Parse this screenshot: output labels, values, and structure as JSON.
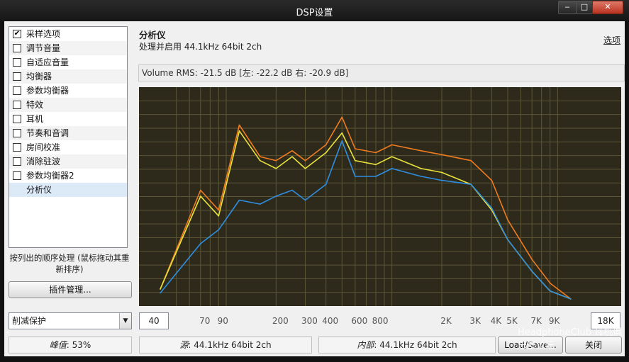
{
  "window": {
    "title": "DSP设置"
  },
  "sidebar": {
    "items": [
      {
        "label": "采样选项",
        "checked": true
      },
      {
        "label": "调节音量",
        "checked": false
      },
      {
        "label": "自适应音量",
        "checked": false
      },
      {
        "label": "均衡器",
        "checked": false
      },
      {
        "label": "参数均衡器",
        "checked": false
      },
      {
        "label": "特效",
        "checked": false
      },
      {
        "label": "耳机",
        "checked": false
      },
      {
        "label": "节奏和音调",
        "checked": false
      },
      {
        "label": "房间校准",
        "checked": false
      },
      {
        "label": "消除驻波",
        "checked": false
      },
      {
        "label": "参数均衡器2",
        "checked": false
      },
      {
        "label": "分析仪",
        "selected": true
      }
    ],
    "order_note": "按列出的顺序处理 (鼠标拖动其重新排序)",
    "plugin_button": "插件管理...",
    "clip_mode": "削减保护"
  },
  "panel": {
    "title": "分析仪",
    "subtitle": "处理并启用 44.1kHz 64bit 2ch",
    "options_link": "选项",
    "rms_text": "Volume RMS: -21.5 dB   [左: -22.2 dB   右: -20.9 dB]"
  },
  "freq": {
    "min": "40",
    "max": "18K",
    "ticks": [
      "70",
      "90",
      "200",
      "300",
      "400",
      "600",
      "800",
      "2K",
      "3K",
      "4K",
      "5K",
      "7K",
      "9K"
    ]
  },
  "statusbar": {
    "peak_label": "峰值",
    "peak_value": ": 53%",
    "source_label": "源",
    "source_value": ": 44.1kHz 64bit 2ch",
    "internal_label": "内部",
    "internal_value": ": 44.1kHz 64bit 2ch",
    "load_save": "Load/Save...",
    "close": "关闭"
  },
  "watermark": "HeadphoneClub 耳机俱乐部论坛",
  "chart_data": {
    "type": "line",
    "x": [
      40,
      70,
      90,
      120,
      160,
      200,
      250,
      300,
      400,
      500,
      600,
      800,
      1000,
      1500,
      2000,
      3000,
      4000,
      5000,
      7000,
      9000,
      12000
    ],
    "series": [
      {
        "values": [
          5,
          55,
          45,
          88,
          72,
          70,
          75,
          70,
          78,
          92,
          76,
          74,
          78,
          75,
          73,
          70,
          60,
          40,
          20,
          8,
          0
        ],
        "color": "#f07a1e"
      },
      {
        "values": [
          5,
          52,
          42,
          85,
          70,
          66,
          72,
          66,
          74,
          84,
          70,
          68,
          72,
          66,
          64,
          58,
          45,
          30,
          14,
          4,
          0
        ],
        "color": "#e8e23a"
      },
      {
        "values": [
          3,
          28,
          35,
          50,
          48,
          52,
          55,
          50,
          58,
          80,
          62,
          62,
          66,
          62,
          60,
          58,
          46,
          30,
          14,
          4,
          0
        ],
        "color": "#2f8ee0"
      }
    ]
  }
}
